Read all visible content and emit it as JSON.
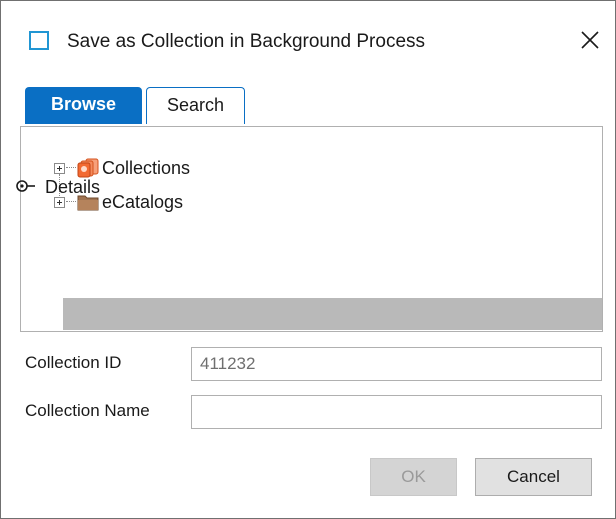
{
  "dialog": {
    "title": "Save as Collection in Background Process",
    "close_glyph": "✕"
  },
  "tabs": [
    {
      "label": "Browse",
      "active": true
    },
    {
      "label": "Search",
      "active": false
    }
  ],
  "tree": {
    "items": [
      {
        "label": "Collections",
        "icon": "collection-icon"
      },
      {
        "label": "eCatalogs",
        "icon": "folder-icon"
      }
    ]
  },
  "details": {
    "label": "Details",
    "icon": "details-toggle-icon"
  },
  "form": {
    "collection_id_label": "Collection ID",
    "collection_id_value": "411232",
    "collection_name_label": "Collection Name",
    "collection_name_value": ""
  },
  "buttons": {
    "ok": "OK",
    "cancel": "Cancel"
  },
  "colors": {
    "accent": "#0a6fc4",
    "title_icon": "#2196d3",
    "collection_icon": "#f26a32",
    "folder_icon": "#a07350",
    "details_bar": "#b9b9b9"
  }
}
